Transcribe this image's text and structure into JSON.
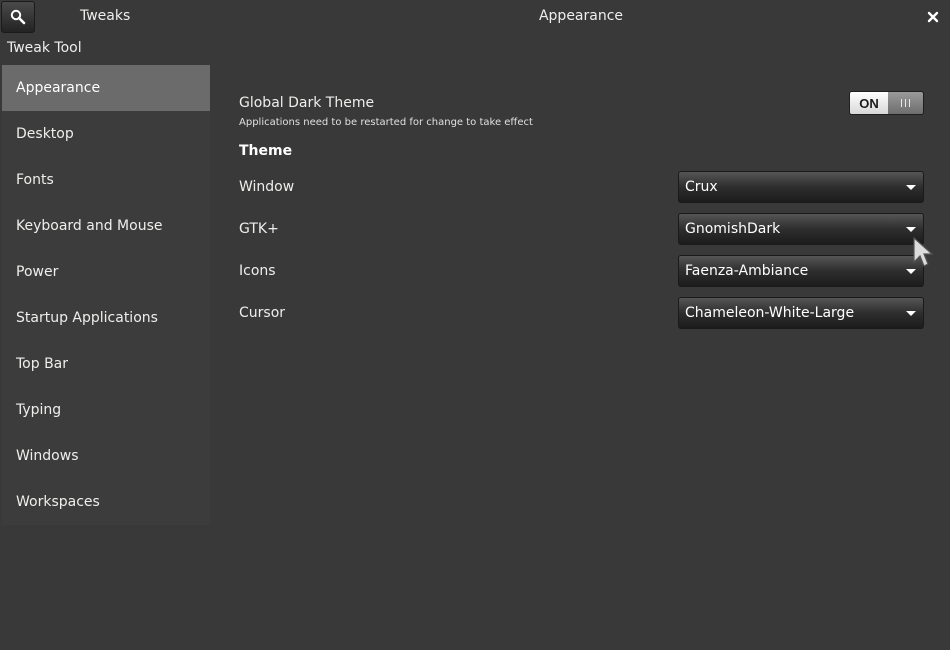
{
  "header": {
    "app_title": "Tweaks",
    "page_title": "Appearance"
  },
  "sidebar": {
    "title": "Tweak Tool",
    "items": [
      {
        "label": "Appearance",
        "selected": true
      },
      {
        "label": "Desktop"
      },
      {
        "label": "Fonts"
      },
      {
        "label": "Keyboard and Mouse"
      },
      {
        "label": "Power"
      },
      {
        "label": "Startup Applications"
      },
      {
        "label": "Top Bar"
      },
      {
        "label": "Typing"
      },
      {
        "label": "Windows"
      },
      {
        "label": "Workspaces"
      }
    ]
  },
  "main": {
    "dark_theme": {
      "label": "Global Dark Theme",
      "description": "Applications need to be restarted for change to take effect",
      "switch_state": "ON"
    },
    "theme_heading": "Theme",
    "themes": [
      {
        "label": "Window",
        "value": "Crux"
      },
      {
        "label": "GTK+",
        "value": "GnomishDark"
      },
      {
        "label": "Icons",
        "value": "Faenza-Ambiance"
      },
      {
        "label": "Cursor",
        "value": "Chameleon-White-Large"
      }
    ]
  },
  "colors": {
    "background": "#393939",
    "sidebar_selected": "#6b6b6b",
    "text": "#eeeeec"
  }
}
